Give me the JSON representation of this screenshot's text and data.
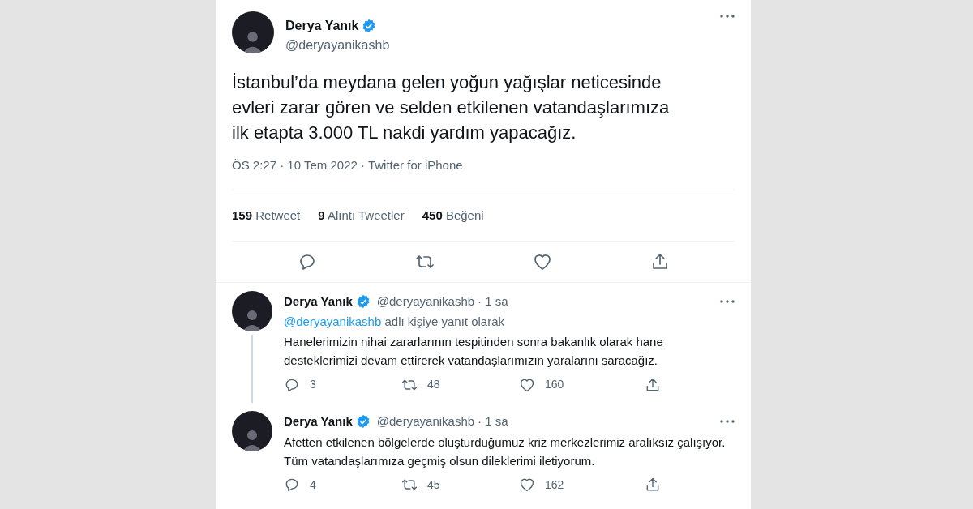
{
  "tweet": {
    "name": "Derya Yanık",
    "verified": true,
    "handle": "@deryayanikashb",
    "text": "İstanbul’da meydana gelen yoğun yağışlar neticesinde evleri zarar gören ve selden etkilenen vatandaşlarımıza ilk etapta 3.000 TL nakdi yardım yapacağız.",
    "meta": "ÖS 2:27 · 10 Tem 2022 · Twitter for iPhone",
    "stats": [
      {
        "count": "159",
        "label": "Retweet"
      },
      {
        "count": "9",
        "label": "Alıntı Tweetler"
      },
      {
        "count": "450",
        "label": "Beğeni"
      }
    ]
  },
  "replies": [
    {
      "name": "Derya Yanık",
      "verified": true,
      "handle": "@deryayanikashb",
      "time": "· 1 sa",
      "reply_to": {
        "mention": "@deryayanikashb",
        "text": "adlı kişiye yanıt olarak"
      },
      "text": "Hanelerimizin nihai zararlarının tespitinden sonra bakanlık olarak hane desteklerimizi devam ettirerek vatandaşlarımızın yaralarını saracağız.",
      "replies": "3",
      "retweets": "48",
      "likes": "160",
      "thread_continues": true
    },
    {
      "name": "Derya Yanık",
      "verified": true,
      "handle": "@deryayanikashb",
      "time": "· 1 sa",
      "text": "Afetten etkilenen bölgelerde oluşturduğumuz kriz merkezlerimiz aralıksız çalışıyor. Tüm vatandaşlarımıza geçmiş olsun dileklerimi iletiyorum.",
      "replies": "4",
      "retweets": "45",
      "likes": "162",
      "thread_continues": false
    }
  ]
}
